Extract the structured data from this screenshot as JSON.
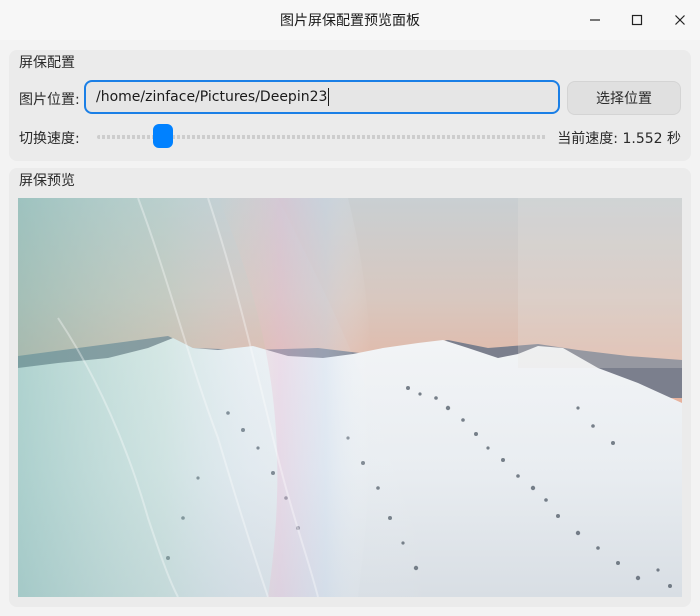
{
  "window": {
    "title": "图片屏保配置预览面板"
  },
  "config_group": {
    "title": "屏保配置",
    "path_label": "图片位置:",
    "path_value": "/home/zinface/Pictures/Deepin23",
    "choose_button": "选择位置",
    "speed_label": "切换速度:",
    "speed_readout": "当前速度: 1.552 秒",
    "accent_color": "#0081ff"
  },
  "preview_group": {
    "title": "屏保预览"
  },
  "icons": {
    "minimize": "minimize-icon",
    "maximize": "maximize-icon",
    "close": "close-icon"
  }
}
